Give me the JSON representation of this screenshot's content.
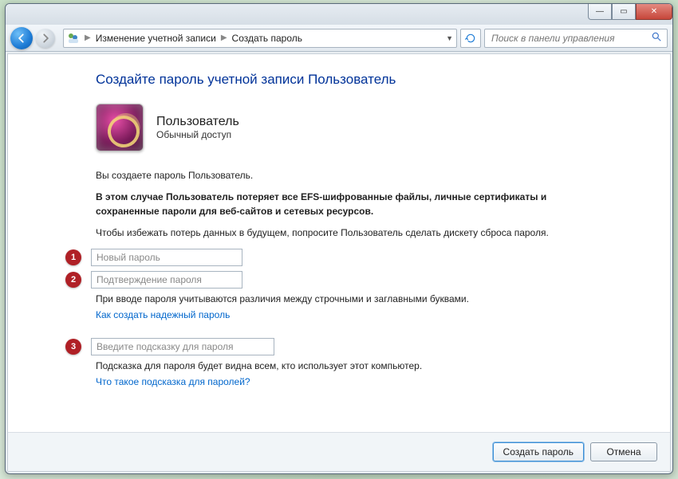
{
  "titlebar": {
    "min": "—",
    "max": "▭",
    "close": "✕"
  },
  "nav": {
    "crumb1": "Изменение учетной записи",
    "crumb2": "Создать пароль",
    "search_placeholder": "Поиск в панели управления"
  },
  "page": {
    "title": "Создайте пароль учетной записи Пользователь",
    "user_name": "Пользователь",
    "user_role": "Обычный доступ",
    "p1": "Вы создаете пароль Пользователь.",
    "p2": "В этом случае Пользователь потеряет все EFS-шифрованные файлы, личные сертификаты и сохраненные пароли для веб-сайтов и сетевых ресурсов.",
    "p3": "Чтобы избежать потерь данных в будущем, попросите Пользователь сделать дискету сброса пароля.",
    "badges": {
      "b1": "1",
      "b2": "2",
      "b3": "3"
    },
    "ph_new": "Новый пароль",
    "ph_confirm": "Подтверждение пароля",
    "ph_hint": "Введите подсказку для пароля",
    "case_note": "При вводе пароля учитываются различия между строчными и заглавными буквами.",
    "link_strong": "Как создать надежный пароль",
    "hint_note": "Подсказка для пароля будет видна всем, кто использует этот компьютер.",
    "link_hint": "Что такое подсказка для паролей?",
    "btn_create": "Создать пароль",
    "btn_cancel": "Отмена"
  }
}
